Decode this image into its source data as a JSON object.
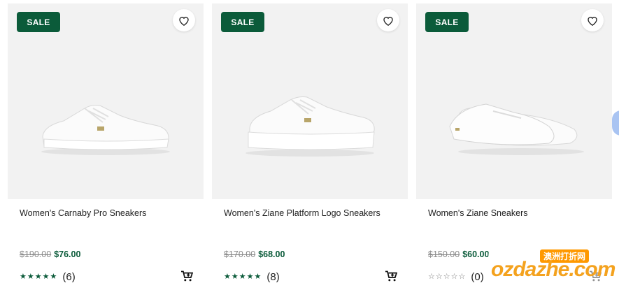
{
  "products": [
    {
      "sale_label": "SALE",
      "title": "Women's Carnaby Pro Sneakers",
      "old_price": "$190.00",
      "new_price": "$76.00",
      "stars_filled": 5,
      "review_count": "(6)",
      "shoe_style": "court"
    },
    {
      "sale_label": "SALE",
      "title": "Women's Ziane Platform Logo Sneakers",
      "old_price": "$170.00",
      "new_price": "$68.00",
      "stars_filled": 5,
      "review_count": "(8)",
      "shoe_style": "platform"
    },
    {
      "sale_label": "SALE",
      "title": "Women's Ziane Sneakers",
      "old_price": "$150.00",
      "new_price": "$60.00",
      "stars_filled": 0,
      "review_count": "(0)",
      "shoe_style": "slip-on"
    }
  ],
  "icons": {
    "wishlist": "heart-icon",
    "add_to_cart": "cart-plus-icon",
    "star": "star-icon"
  },
  "colors": {
    "brand_green": "#0b5b3a",
    "image_bg": "#f2f2f2",
    "strike_grey": "#8a8a8a"
  },
  "watermark": {
    "tag": "澳洲打折网",
    "text": "ozdazhe.com"
  }
}
